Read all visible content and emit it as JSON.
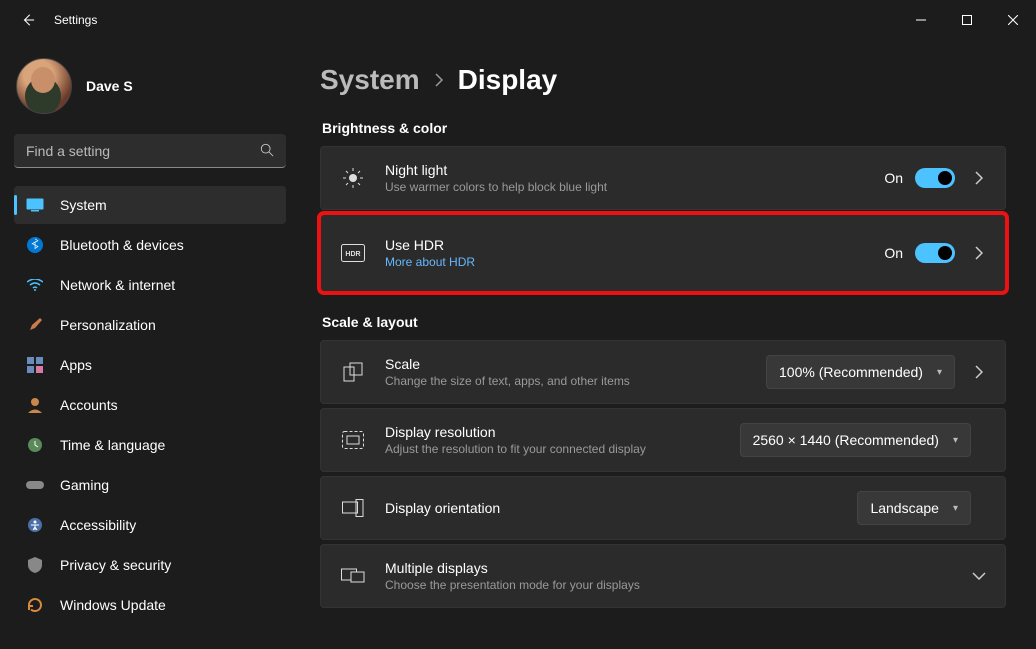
{
  "window": {
    "title": "Settings"
  },
  "user": {
    "name": "Dave S"
  },
  "search": {
    "placeholder": "Find a setting"
  },
  "nav": [
    {
      "label": "System",
      "selected": true
    },
    {
      "label": "Bluetooth & devices"
    },
    {
      "label": "Network & internet"
    },
    {
      "label": "Personalization"
    },
    {
      "label": "Apps"
    },
    {
      "label": "Accounts"
    },
    {
      "label": "Time & language"
    },
    {
      "label": "Gaming"
    },
    {
      "label": "Accessibility"
    },
    {
      "label": "Privacy & security"
    },
    {
      "label": "Windows Update"
    }
  ],
  "breadcrumb": {
    "parent": "System",
    "current": "Display"
  },
  "sections": {
    "brightness": {
      "title": "Brightness & color"
    },
    "scale": {
      "title": "Scale & layout"
    }
  },
  "cards": {
    "night_light": {
      "title": "Night light",
      "sub": "Use warmer colors to help block blue light",
      "state": "On"
    },
    "hdr": {
      "title": "Use HDR",
      "link": "More about HDR",
      "state": "On"
    },
    "scale": {
      "title": "Scale",
      "sub": "Change the size of text, apps, and other items",
      "value": "100% (Recommended)"
    },
    "resolution": {
      "title": "Display resolution",
      "sub": "Adjust the resolution to fit your connected display",
      "value": "2560 × 1440 (Recommended)"
    },
    "orientation": {
      "title": "Display orientation",
      "value": "Landscape"
    },
    "multiple": {
      "title": "Multiple displays",
      "sub": "Choose the presentation mode for your displays"
    }
  }
}
